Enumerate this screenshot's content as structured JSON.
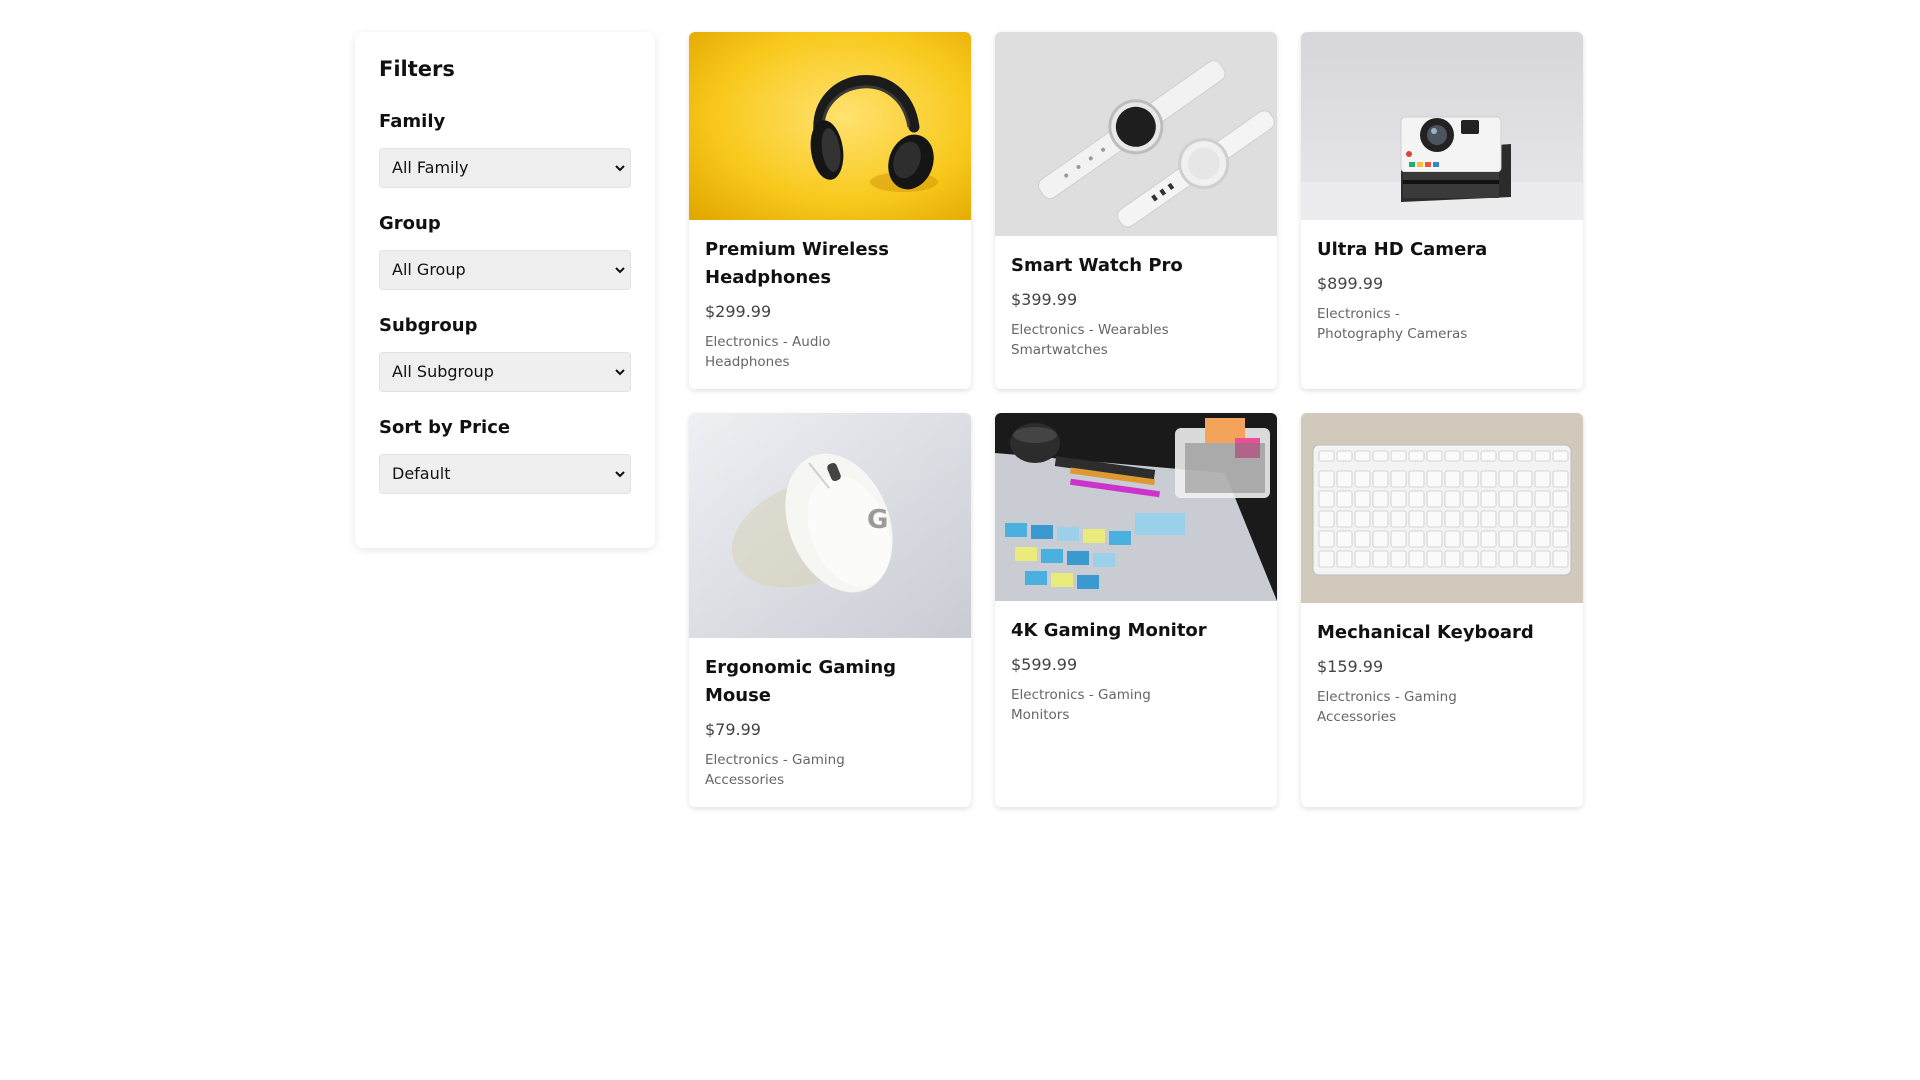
{
  "filters": {
    "title": "Filters",
    "family": {
      "label": "Family",
      "selected": "All Family"
    },
    "group": {
      "label": "Group",
      "selected": "All Group"
    },
    "subgroup": {
      "label": "Subgroup",
      "selected": "All Subgroup"
    },
    "sort": {
      "label": "Sort by Price",
      "selected": "Default"
    }
  },
  "products": [
    {
      "name": "Premium Wireless Headphones",
      "price": "$299.99",
      "category": "Electronics - Audio Headphones",
      "image_icon": "headphones-image"
    },
    {
      "name": "Smart Watch Pro",
      "price": "$399.99",
      "category": "Electronics - Wearables Smartwatches",
      "image_icon": "smartwatch-image"
    },
    {
      "name": "Ultra HD Camera",
      "price": "$899.99",
      "category": "Electronics - Photography Cameras",
      "image_icon": "camera-image"
    },
    {
      "name": "Ergonomic Gaming Mouse",
      "price": "$79.99",
      "category": "Electronics - Gaming Accessories",
      "image_icon": "mouse-image"
    },
    {
      "name": "4K Gaming Monitor",
      "price": "$599.99",
      "category": "Electronics - Gaming Monitors",
      "image_icon": "monitor-desk-image"
    },
    {
      "name": "Mechanical Keyboard",
      "price": "$159.99",
      "category": "Electronics - Gaming Accessories",
      "image_icon": "keyboard-image"
    }
  ],
  "colors": {
    "headphones_bg": "#f8c91c",
    "watch_bg": "#e1e1e1",
    "camera_bg": "#dcdcdc",
    "mouse_bg": "#e6e8ec",
    "keyboard_bg": "#cfc8bc"
  }
}
